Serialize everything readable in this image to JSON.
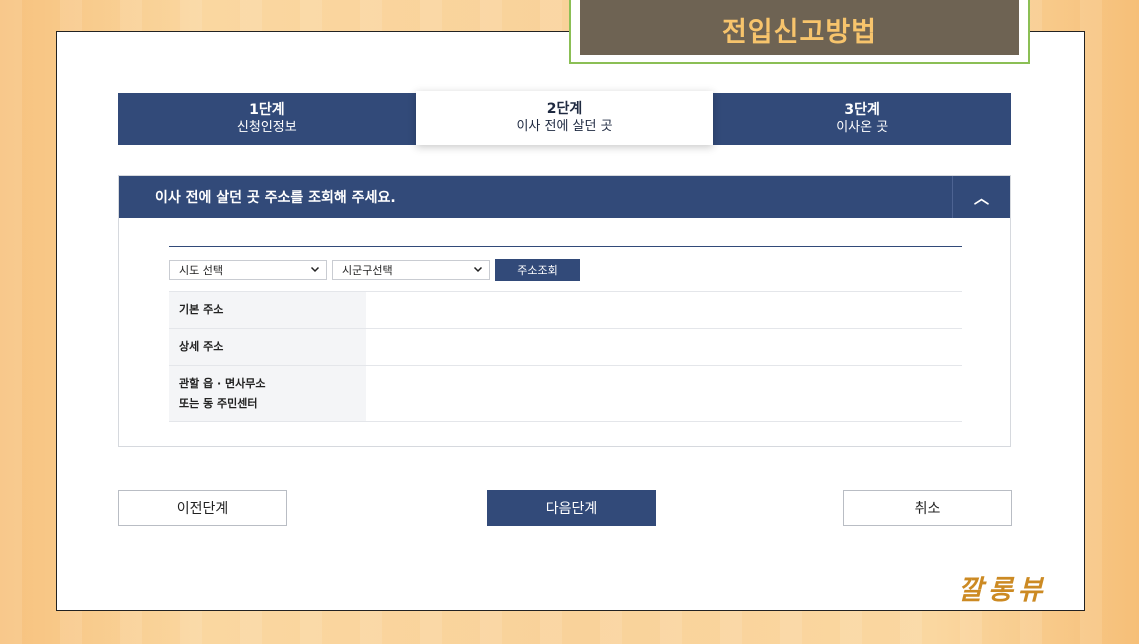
{
  "banner": {
    "title": "전입신고방법"
  },
  "steps": [
    {
      "num": "1단계",
      "label": "신청인정보"
    },
    {
      "num": "2단계",
      "label": "이사 전에 살던 곳"
    },
    {
      "num": "3단계",
      "label": "이사온 곳"
    }
  ],
  "active_step": 2,
  "panel": {
    "heading": "이사 전에 살던 곳 주소를 조회해 주세요.",
    "collapse_glyph": "︿"
  },
  "selects": {
    "sido": {
      "value": "시도 선택"
    },
    "sigungu": {
      "value": "시군구선택"
    }
  },
  "lookup_button": "주소조회",
  "address_rows": {
    "base": {
      "label": "기본 주소",
      "value": ""
    },
    "detail": {
      "label": "상세 주소",
      "value": ""
    },
    "office": {
      "label_line1": "관할 읍 · 면사무소",
      "label_line2": "또는 동 주민센터",
      "value": ""
    }
  },
  "buttons": {
    "prev": "이전단계",
    "next": "다음단계",
    "cancel": "취소"
  },
  "watermark": "깔롱뷰",
  "colors": {
    "navy": "#324a79",
    "banner_bg": "#6e6353",
    "banner_text": "#f7c46c",
    "banner_border": "#8bbf55",
    "watermark": "#cc8a23"
  }
}
